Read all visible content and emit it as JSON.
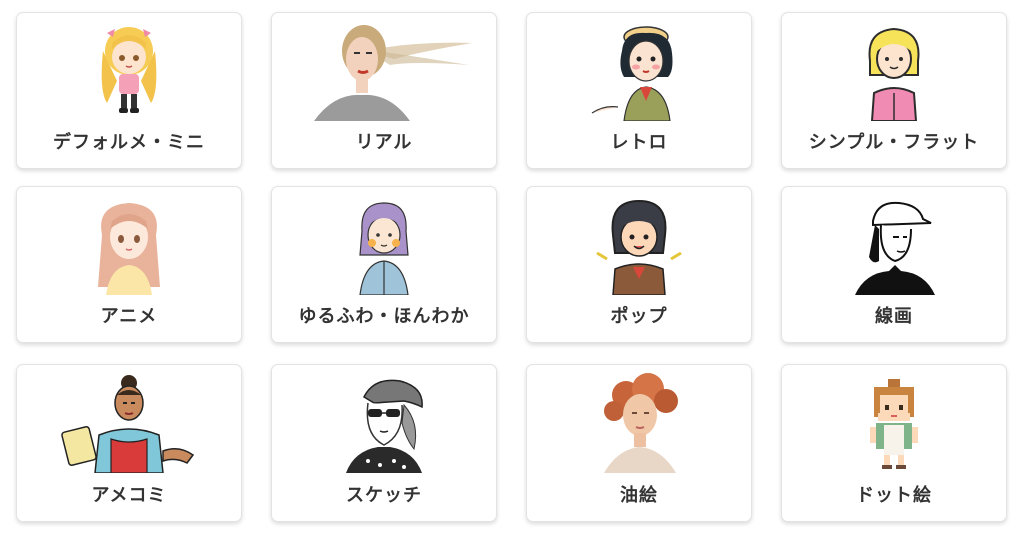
{
  "styles": [
    {
      "label": "デフォルメ・ミニ",
      "icon": "chibi-girl-icon"
    },
    {
      "label": "リアル",
      "icon": "realistic-woman-icon"
    },
    {
      "label": "レトロ",
      "icon": "retro-woman-icon"
    },
    {
      "label": "シンプル・フラット",
      "icon": "flat-girl-icon"
    },
    {
      "label": "アニメ",
      "icon": "anime-girl-icon"
    },
    {
      "label": "ゆるふわ・ほんわか",
      "icon": "soft-girl-icon"
    },
    {
      "label": "ポップ",
      "icon": "pop-girl-icon"
    },
    {
      "label": "線画",
      "icon": "line-art-icon"
    },
    {
      "label": "アメコミ",
      "icon": "american-comic-icon"
    },
    {
      "label": "スケッチ",
      "icon": "sketch-woman-icon"
    },
    {
      "label": "油絵",
      "icon": "oil-painting-icon"
    },
    {
      "label": "ドット絵",
      "icon": "pixel-art-icon"
    }
  ]
}
